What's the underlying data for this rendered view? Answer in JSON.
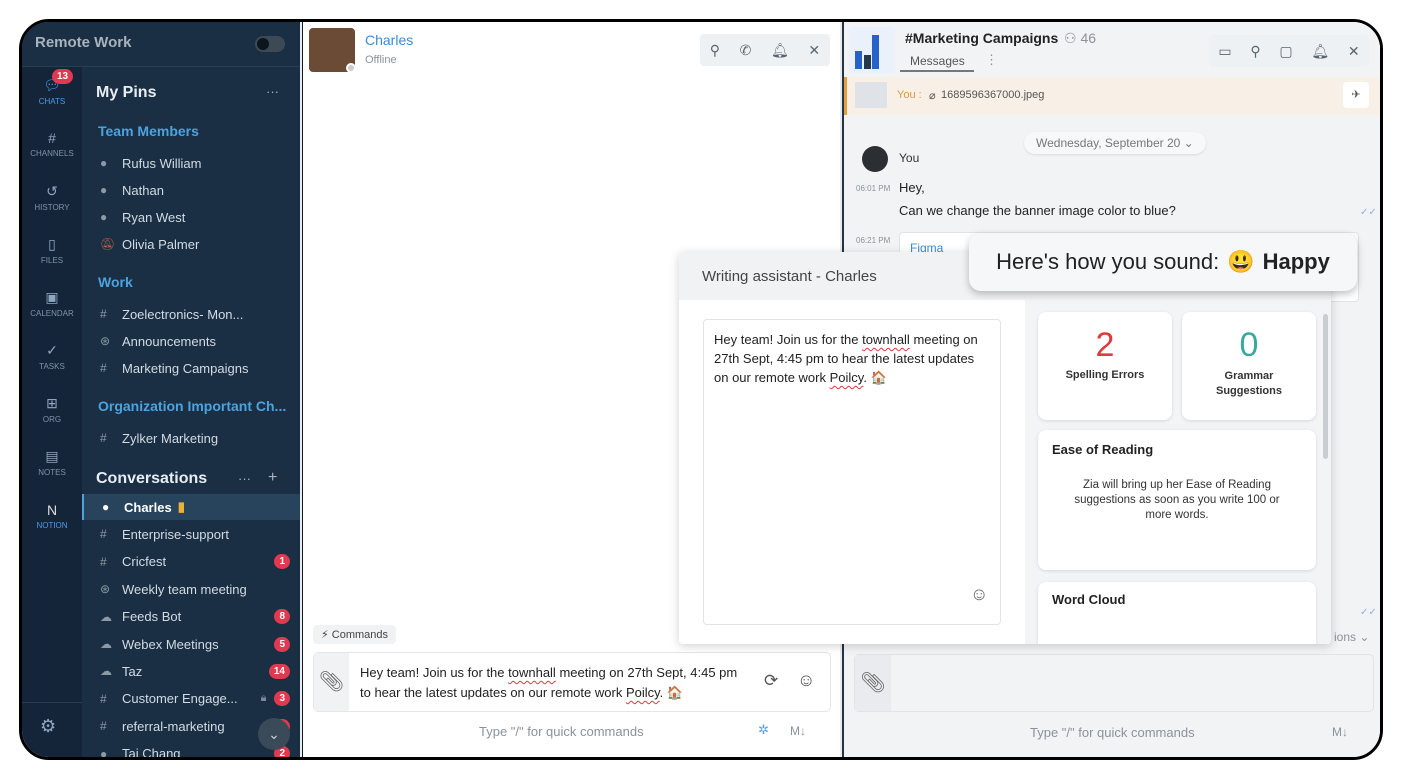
{
  "workspace": {
    "name": "Remote Work"
  },
  "rail": [
    {
      "label": "CHATS",
      "icon": "chat-icon",
      "badge": "13"
    },
    {
      "label": "CHANNELS",
      "icon": "hash-icon"
    },
    {
      "label": "HISTORY",
      "icon": "history-icon"
    },
    {
      "label": "FILES",
      "icon": "file-icon"
    },
    {
      "label": "CALENDAR",
      "icon": "calendar-icon"
    },
    {
      "label": "TASKS",
      "icon": "tasks-icon"
    },
    {
      "label": "ORG",
      "icon": "org-icon"
    },
    {
      "label": "NOTES",
      "icon": "notes-icon"
    },
    {
      "label": "NOTION",
      "icon": "notion-icon"
    }
  ],
  "sidebar": {
    "pins_title": "My Pins",
    "team_title": "Team Members",
    "team": [
      "Rufus William",
      "Nathan",
      "Ryan West",
      "Olivia Palmer"
    ],
    "work_title": "Work",
    "work": [
      "Zoelectronics- Mon...",
      "Announcements",
      "Marketing Campaigns"
    ],
    "org_title": "Organization Important Ch...",
    "org": [
      "Zylker Marketing"
    ],
    "conv_title": "Conversations",
    "conversations": [
      {
        "name": "Charles"
      },
      {
        "name": "Enterprise-support"
      },
      {
        "name": "Cricfest",
        "badge": "1"
      },
      {
        "name": "Weekly team meeting"
      },
      {
        "name": "Feeds Bot",
        "badge": "8"
      },
      {
        "name": "Webex Meetings",
        "badge": "5"
      },
      {
        "name": "Taz",
        "badge": "14"
      },
      {
        "name": "Customer Engage...",
        "badge": "3"
      },
      {
        "name": "referral-marketing",
        "badge": "7"
      },
      {
        "name": "Tai Chang",
        "badge": "2"
      }
    ]
  },
  "chat": {
    "name": "Charles",
    "status": "Offline",
    "commands_label": "Commands",
    "composer_line1": "Hey team! Join us for the ",
    "composer_word1": "townhall",
    "composer_line1b": " meeting on 27th Sept, 4:45 pm",
    "composer_line2": "to hear the latest updates on our remote work ",
    "composer_word2": "Poilcy",
    "composer_line2b": ". 🏠",
    "hint": "Type \"/\" for quick commands",
    "md": "M↓"
  },
  "channel": {
    "name": "#Marketing Campaigns",
    "members": "46",
    "tab": "Messages",
    "pinned_you": "You :",
    "pinned_file": "1689596367000.jpeg",
    "date": "Wednesday, September 20",
    "sender": "You",
    "time1": "06:01 PM",
    "msg1": "Hey,",
    "msg2": "Can we change the banner image color to blue?",
    "time2": "06:21 PM",
    "link": "Figma",
    "options": "ions",
    "hint": "Type \"/\" for quick commands",
    "md": "M↓"
  },
  "assistant": {
    "title": "Writing assistant - Charles",
    "tone_prefix": "Here's how you sound:",
    "tone_emoji": "😃",
    "tone": "Happy",
    "text_a": "Hey team! Join us for the ",
    "text_w1": "townhall",
    "text_b": " meeting on 27th Sept, 4:45 pm to hear the latest updates on our remote work ",
    "text_w2": "Poilcy",
    "text_c": ". 🏠",
    "spelling_count": "2",
    "spelling_label": "Spelling Errors",
    "grammar_count": "0",
    "grammar_label": "Grammar Suggestions",
    "ease_title": "Ease of Reading",
    "ease_text": "Zia will bring up her Ease of Reading suggestions as soon as you write 100 or more words.",
    "cloud_title": "Word Cloud"
  },
  "colors": {
    "accent": "#4ba3e0",
    "badge": "#e1394f",
    "spelling": "#e0393e",
    "grammar": "#3aa89a"
  }
}
